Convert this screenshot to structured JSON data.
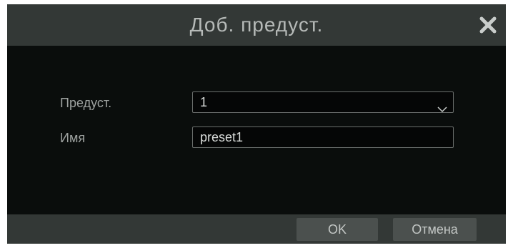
{
  "dialog": {
    "title": "Доб. предуст.",
    "close_icon": "close-icon"
  },
  "form": {
    "preset_label": "Предуст.",
    "preset_value": "1",
    "preset_dropdown_icon": "chevron-down-icon",
    "name_label": "Имя",
    "name_value": "preset1"
  },
  "footer": {
    "ok_label": "OK",
    "cancel_label": "Отмена"
  },
  "colors": {
    "panel_bg": "#0a0d0c",
    "bar_bg": "#333836",
    "button_bg": "#4b504e",
    "text": "#b6bab8"
  }
}
